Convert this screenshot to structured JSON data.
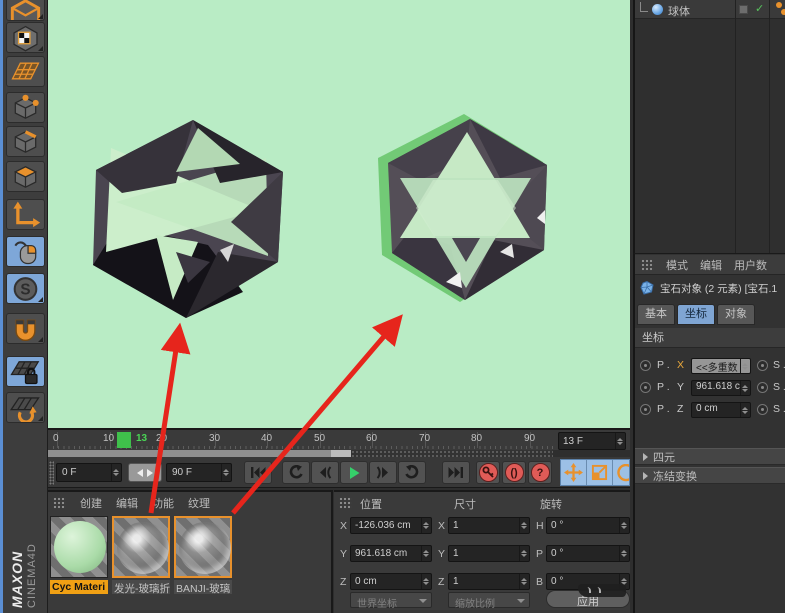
{
  "icons": {
    "snap_glyph": "S",
    "autokey_glyph": "()",
    "question_glyph": "?"
  },
  "branding": {
    "line1": "MAXON",
    "line2": "CINEMA4D"
  },
  "object_manager": {
    "item_label": "球体"
  },
  "attribute_manager": {
    "menu": [
      "模式",
      "编辑",
      "用户数"
    ],
    "object_title": "宝石对象 (2 元素) [宝石.1",
    "tabs": [
      "基本",
      "坐标",
      "对象"
    ],
    "section_title": "坐标",
    "rows": [
      {
        "prefix": "P .",
        "axis": "X",
        "value": "<<多重数",
        "right": "S ."
      },
      {
        "prefix": "P .",
        "axis": "Y",
        "value": "961.618 c",
        "right": "S ."
      },
      {
        "prefix": "P .",
        "axis": "Z",
        "value": "0 cm",
        "right": "S ."
      }
    ],
    "groups": [
      "四元",
      "冻结变换"
    ]
  },
  "timeline": {
    "ticks": [
      "0",
      "10",
      "20",
      "30",
      "40",
      "50",
      "60",
      "70",
      "80",
      "90"
    ],
    "current_frame": "13",
    "frame_field": "13 F",
    "range_start": "0 F",
    "range_end": "90 F"
  },
  "materials": {
    "menu": [
      "创建",
      "编辑",
      "功能",
      "纹理"
    ],
    "items": [
      {
        "label": "Cyc Materi"
      },
      {
        "label": "发光-玻璃折"
      },
      {
        "label": "BANJI-玻璃"
      }
    ]
  },
  "coords_panel": {
    "headers": [
      "位置",
      "尺寸",
      "旋转"
    ],
    "pos_labels": [
      "X",
      "Y",
      "Z"
    ],
    "size_labels": [
      "X",
      "Y",
      "Z"
    ],
    "rot_labels": [
      "H",
      "P",
      "B"
    ],
    "position": [
      "-126.036 cm",
      "961.618 cm",
      "0 cm"
    ],
    "size": [
      "1",
      "1",
      "1"
    ],
    "rotation": [
      "0 °",
      "0 °",
      "0 °"
    ],
    "space_dropdown": "世界坐标",
    "scale_dropdown": "缩放比例",
    "apply_label": "应用"
  }
}
